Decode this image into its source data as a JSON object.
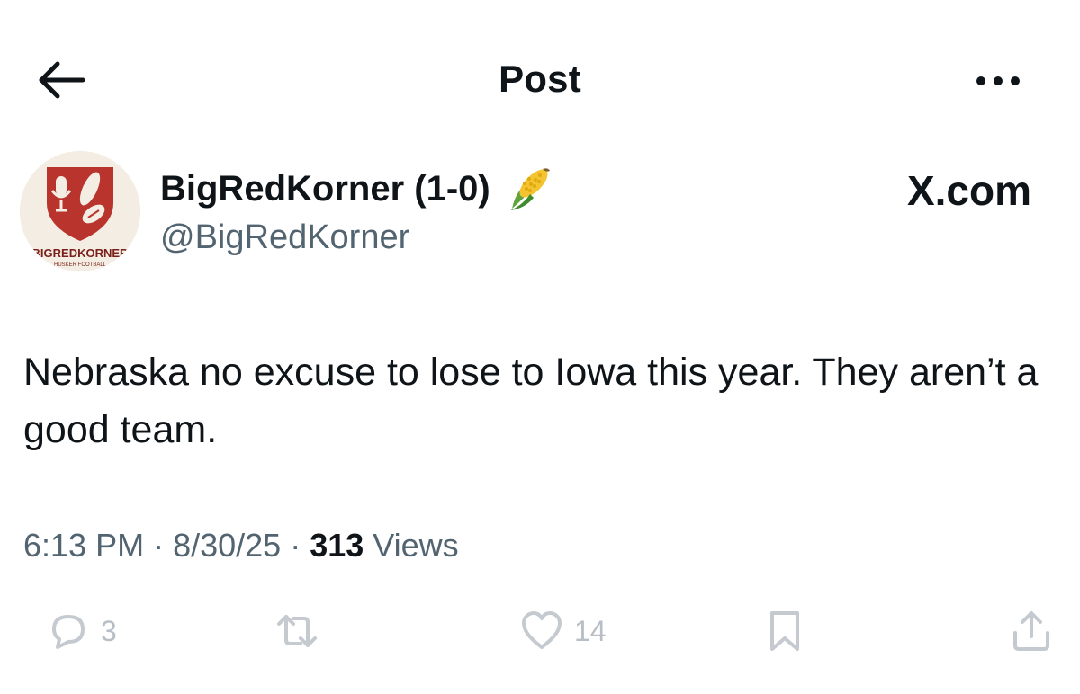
{
  "header": {
    "title": "Post"
  },
  "author": {
    "display_name": "BigRedKorner (1-0)",
    "handle": "@BigRedKorner",
    "avatar_text": "BIGREDKORNER",
    "avatar_subtext": "HUSKER FOOTBALL",
    "badge_icon": "corn-emoji-icon"
  },
  "source_mark": "X.com",
  "post": {
    "text": "Nebraska no excuse to lose to Iowa this year. They aren’t a good team."
  },
  "meta": {
    "time": "6:13 PM",
    "sep1": " · ",
    "date": "8/30/25",
    "sep2": " · ",
    "views_count": "313",
    "views_label": " Views"
  },
  "actions": {
    "replies": "3",
    "reposts": "",
    "likes": "14"
  },
  "colors": {
    "text": "#0f1419",
    "muted": "#536471",
    "action_icons": "#c4cacf",
    "brand_red": "#b8342c"
  }
}
